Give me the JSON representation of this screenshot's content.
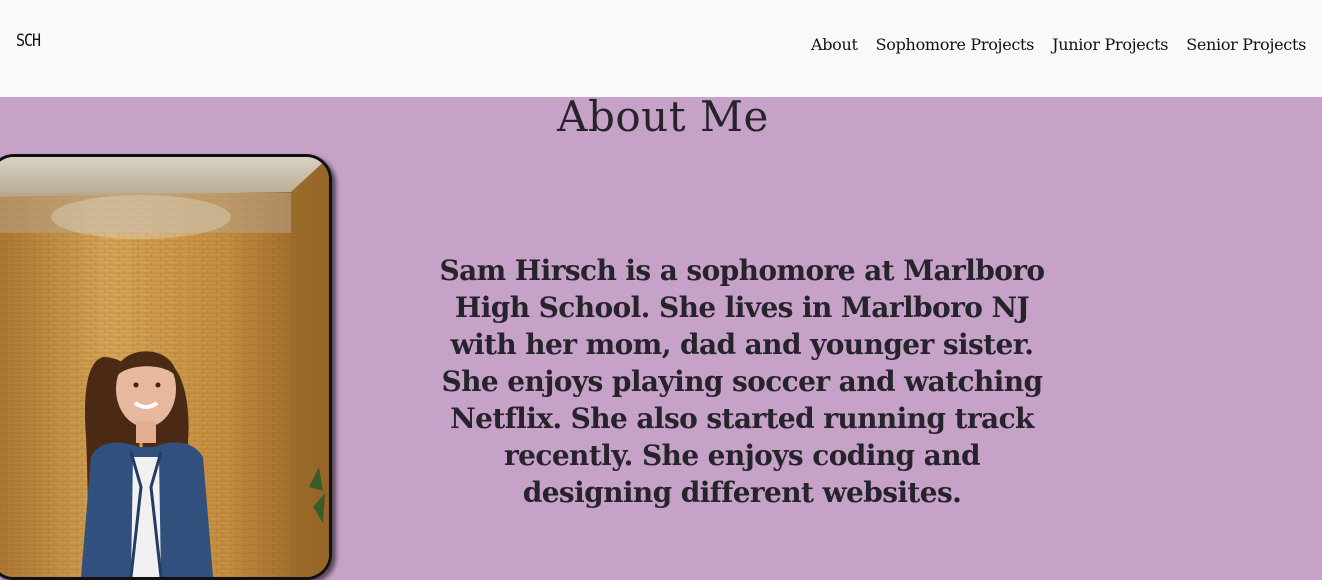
{
  "header": {
    "logo_text": "SCH",
    "nav": [
      {
        "label": "About"
      },
      {
        "label": "Sophomore Projects"
      },
      {
        "label": "Junior Projects"
      },
      {
        "label": "Senior Projects"
      }
    ]
  },
  "about": {
    "title": "About Me",
    "bio": "Sam Hirsch is a sophomore at Marlboro High School. She lives in Marlboro NJ with her mom, dad and younger sister. She enjoys playing soccer and watching Netflix. She also started running track recently. She enjoys coding and designing different websites."
  },
  "colors": {
    "header_bg": "#f8f9fb",
    "page_bg": "#c6a2c8",
    "text": "#27232b"
  }
}
